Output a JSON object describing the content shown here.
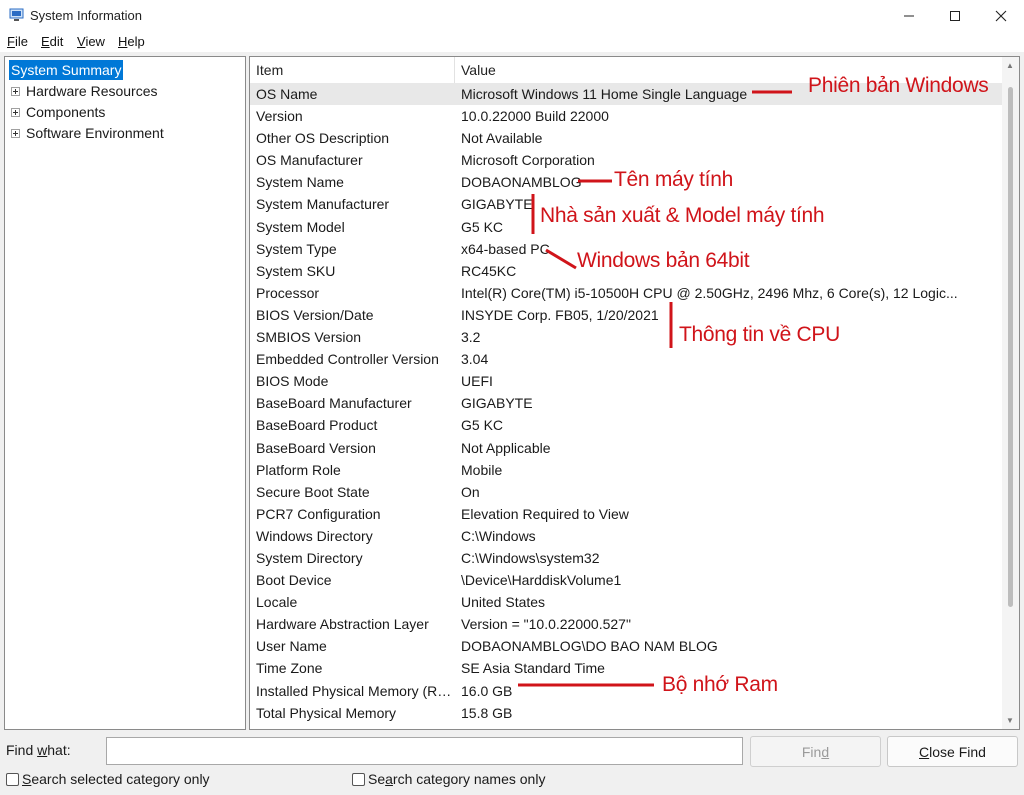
{
  "window": {
    "title": "System Information"
  },
  "menu": {
    "file": "File",
    "edit": "Edit",
    "view": "View",
    "help": "Help"
  },
  "tree": {
    "selected": "System Summary",
    "children": [
      "Hardware Resources",
      "Components",
      "Software Environment"
    ]
  },
  "list": {
    "columns": {
      "item": "Item",
      "value": "Value"
    },
    "rows": [
      {
        "item": "OS Name",
        "value": "Microsoft Windows 11 Home Single Language"
      },
      {
        "item": "Version",
        "value": "10.0.22000 Build 22000"
      },
      {
        "item": "Other OS Description",
        "value": "Not Available"
      },
      {
        "item": "OS Manufacturer",
        "value": "Microsoft Corporation"
      },
      {
        "item": "System Name",
        "value": "DOBAONAMBLOG"
      },
      {
        "item": "System Manufacturer",
        "value": "GIGABYTE"
      },
      {
        "item": "System Model",
        "value": "G5 KC"
      },
      {
        "item": "System Type",
        "value": "x64-based PC"
      },
      {
        "item": "System SKU",
        "value": "RC45KC"
      },
      {
        "item": "Processor",
        "value": "Intel(R) Core(TM) i5-10500H CPU @ 2.50GHz, 2496 Mhz, 6 Core(s), 12 Logic..."
      },
      {
        "item": "BIOS Version/Date",
        "value": "INSYDE Corp. FB05, 1/20/2021"
      },
      {
        "item": "SMBIOS Version",
        "value": "3.2"
      },
      {
        "item": "Embedded Controller Version",
        "value": "3.04"
      },
      {
        "item": "BIOS Mode",
        "value": "UEFI"
      },
      {
        "item": "BaseBoard Manufacturer",
        "value": "GIGABYTE"
      },
      {
        "item": "BaseBoard Product",
        "value": "G5 KC"
      },
      {
        "item": "BaseBoard Version",
        "value": "Not Applicable"
      },
      {
        "item": "Platform Role",
        "value": "Mobile"
      },
      {
        "item": "Secure Boot State",
        "value": "On"
      },
      {
        "item": "PCR7 Configuration",
        "value": "Elevation Required to View"
      },
      {
        "item": "Windows Directory",
        "value": "C:\\Windows"
      },
      {
        "item": "System Directory",
        "value": "C:\\Windows\\system32"
      },
      {
        "item": "Boot Device",
        "value": "\\Device\\HarddiskVolume1"
      },
      {
        "item": "Locale",
        "value": "United States"
      },
      {
        "item": "Hardware Abstraction Layer",
        "value": "Version = \"10.0.22000.527\""
      },
      {
        "item": "User Name",
        "value": "DOBAONAMBLOG\\DO BAO NAM BLOG"
      },
      {
        "item": "Time Zone",
        "value": "SE Asia Standard Time"
      },
      {
        "item": "Installed Physical Memory (RAM)",
        "value": "16.0 GB"
      },
      {
        "item": "Total Physical Memory",
        "value": "15.8 GB"
      }
    ]
  },
  "annotations": {
    "windows_edition": "Phiên bản Windows",
    "computer_name": "Tên máy tính",
    "manufacturer_model": "Nhà sản xuất & Model máy tính",
    "windows_64bit": "Windows bản 64bit",
    "cpu_info": "Thông tin về CPU",
    "ram": "Bộ nhớ Ram"
  },
  "find": {
    "label": "Find what:",
    "value": "",
    "find_button": "Find",
    "close_button": "Close Find",
    "search_selected": "Search selected category only",
    "search_names": "Search category names only"
  },
  "colors": {
    "selection": "#0078d7",
    "annotation": "#d0141a",
    "accent_icon": "#2b6cc4"
  }
}
